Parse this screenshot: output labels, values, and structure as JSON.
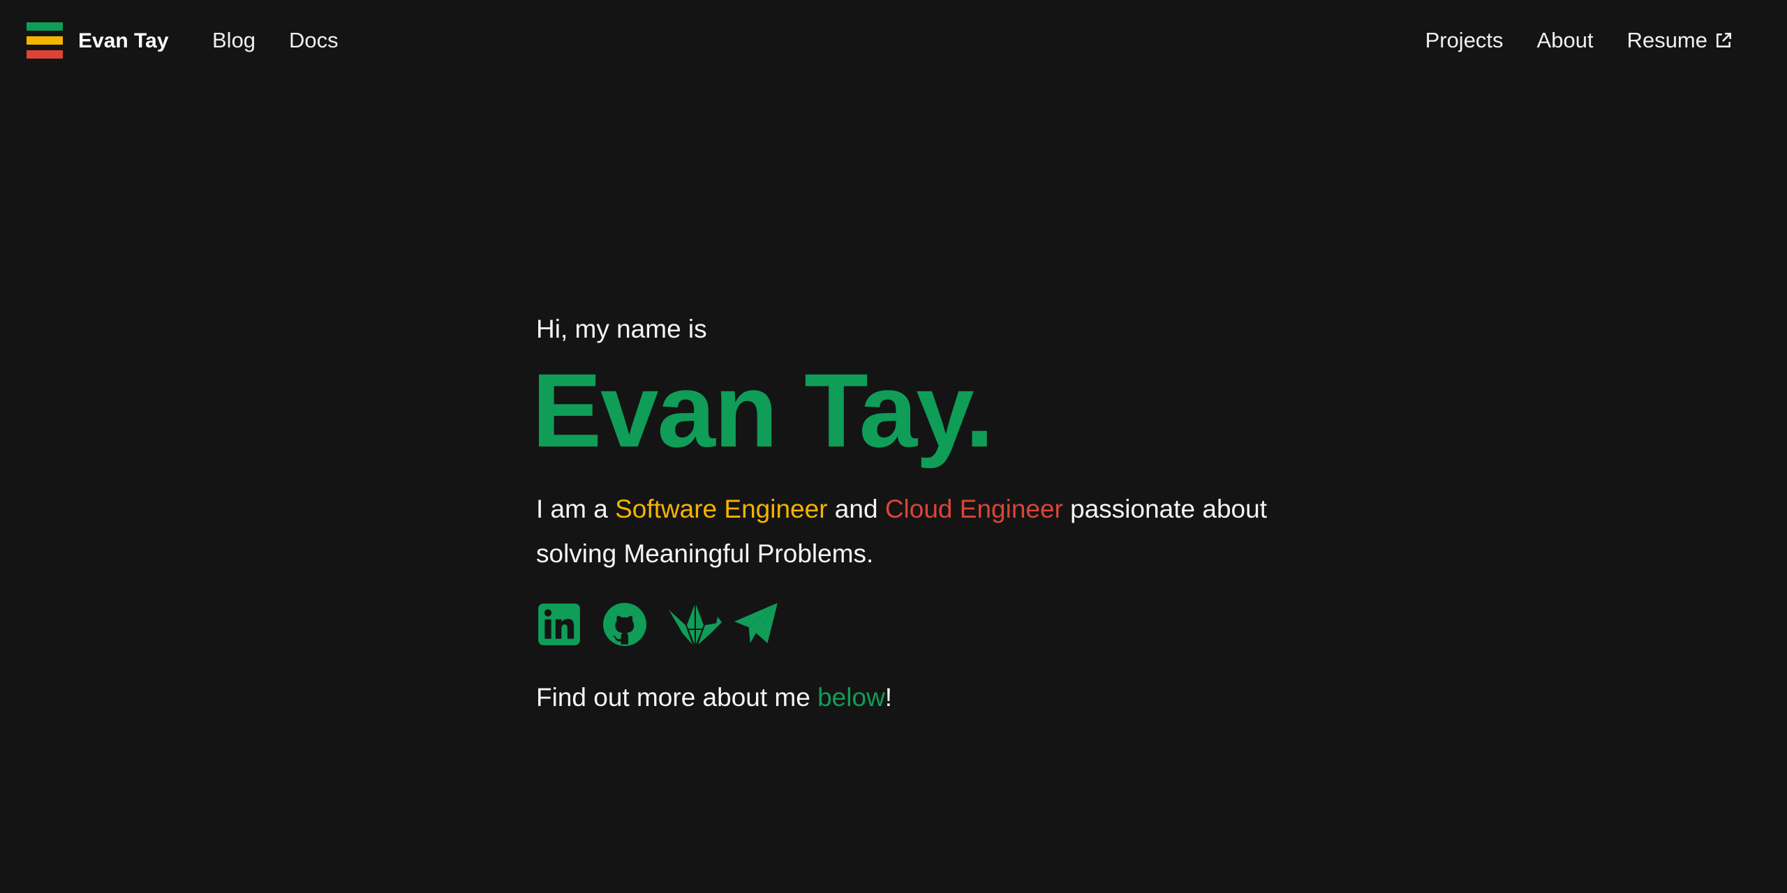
{
  "colors": {
    "background": "#141414",
    "green": "#0f9d58",
    "yellow": "#f4b400",
    "red": "#db4437",
    "text": "#f5f5f5"
  },
  "navbar": {
    "logo_icon": "stacked-bars-logo",
    "brand": "Evan Tay",
    "left_links": [
      {
        "label": "Blog"
      },
      {
        "label": "Docs"
      }
    ],
    "right_links": [
      {
        "label": "Projects"
      },
      {
        "label": "About"
      },
      {
        "label": "Resume",
        "icon": "external-link-icon"
      }
    ]
  },
  "hero": {
    "greeting": "Hi, my name is",
    "name": "Evan Tay.",
    "tagline": {
      "prefix": "I am a ",
      "role1": "Software Engineer",
      "middle": " and ",
      "role2": "Cloud Engineer",
      "suffix": " passionate about solving Meaningful Problems."
    },
    "socials": [
      {
        "icon": "linkedin-icon"
      },
      {
        "icon": "github-icon"
      },
      {
        "icon": "origami-bird-icon"
      },
      {
        "icon": "telegram-icon"
      }
    ],
    "cta": {
      "prefix": "Find out more about me ",
      "link": "below",
      "suffix": "!"
    }
  }
}
